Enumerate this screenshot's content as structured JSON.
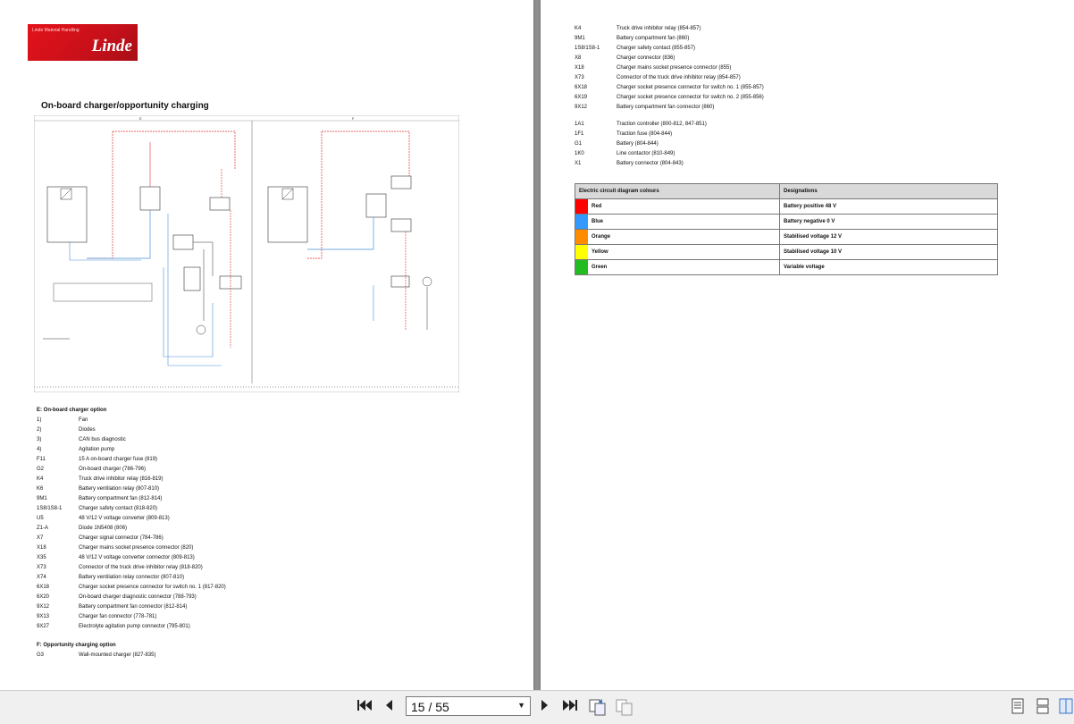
{
  "left_page": {
    "logo": {
      "subtitle": "Linde Material Handling",
      "brand": "Linde"
    },
    "title": "On-board charger/opportunity charging",
    "schematic_sections": [
      "E",
      "F"
    ],
    "legend_e": {
      "heading": "E: On-board charger option",
      "rows": [
        {
          "code": "1)",
          "desc": "Fan"
        },
        {
          "code": "2)",
          "desc": "Diodes"
        },
        {
          "code": "3)",
          "desc": "CAN bus diagnostic"
        },
        {
          "code": "4)",
          "desc": "Agitation pump"
        },
        {
          "code": "F11",
          "desc": "15 A on-board charger fuse (819)"
        },
        {
          "code": "G2",
          "desc": "On-board charger (786-796)"
        },
        {
          "code": "K4",
          "desc": "Truck drive inhibitor relay (816-819)"
        },
        {
          "code": "K6",
          "desc": "Battery ventilation relay (807-810)"
        },
        {
          "code": "9M1",
          "desc": "Battery compartment fan (812-814)"
        },
        {
          "code": "1S8/1S8-1",
          "desc": "Charger safety contact (818-820)"
        },
        {
          "code": "U5",
          "desc": "48 V/12 V voltage converter (809-813)"
        },
        {
          "code": "Z1-A",
          "desc": "Diode 1N5408 (806)"
        },
        {
          "code": "X7",
          "desc": "Charger signal connector (784-786)"
        },
        {
          "code": "X18",
          "desc": "Charger mains socket presence connector (820)"
        },
        {
          "code": "X35",
          "desc": "48 V/12 V voltage converter connector (809-813)"
        },
        {
          "code": "X73",
          "desc": "Connector of the truck drive inhibitor relay (818-820)"
        },
        {
          "code": "X74",
          "desc": "Battery ventilation relay connector (807-810)"
        },
        {
          "code": "6X18",
          "desc": "Charger socket presence connector for switch no. 1 (817-820)"
        },
        {
          "code": "6X20",
          "desc": "On-board charger diagnostic connector (788-793)"
        },
        {
          "code": "9X12",
          "desc": "Battery compartment fan connector (812-814)"
        },
        {
          "code": "9X13",
          "desc": "Charger fan connector (778-781)"
        },
        {
          "code": "9X27",
          "desc": "Electrolyte agitation pump connector (795-801)"
        }
      ]
    },
    "legend_f": {
      "heading": "F: Opportunity charging option",
      "rows": [
        {
          "code": "G3",
          "desc": "Wall-mounted charger (827-835)"
        }
      ]
    }
  },
  "right_page": {
    "legend_top": [
      {
        "code": "K4",
        "desc": "Truck drive inhibitor relay (854-857)"
      },
      {
        "code": "9M1",
        "desc": "Battery compartment fan (860)"
      },
      {
        "code": "1S8/1S8-1",
        "desc": "Charger safety contact (855-857)"
      },
      {
        "code": "X8",
        "desc": "Charger connector (836)"
      },
      {
        "code": "X18",
        "desc": "Charger mains socket presence connector (855)"
      },
      {
        "code": "X73",
        "desc": "Connector of the truck drive inhibitor relay (854-857)"
      },
      {
        "code": "6X18",
        "desc": "Charger socket presence connector for switch no. 1 (855-857)"
      },
      {
        "code": "6X19",
        "desc": "Charger socket presence connector for switch no. 2 (855-856)"
      },
      {
        "code": "9X12",
        "desc": "Battery compartment fan connector (860)"
      }
    ],
    "legend_bottom": [
      {
        "code": "1A1",
        "desc": "Traction controller (800-812, 847-851)"
      },
      {
        "code": "1F1",
        "desc": "Traction fuse (804-844)"
      },
      {
        "code": "G1",
        "desc": "Battery (804-844)"
      },
      {
        "code": "1K0",
        "desc": "Line contactor (810-849)"
      },
      {
        "code": "X1",
        "desc": "Battery connector (804-843)"
      }
    ],
    "color_table": {
      "headers": [
        "Electric circuit diagram colours",
        "Designations"
      ],
      "rows": [
        {
          "color_name": "Red",
          "hex": "#ff0000",
          "designation": "Battery positive 48 V"
        },
        {
          "color_name": "Blue",
          "hex": "#3399ff",
          "designation": "Battery negative 0 V"
        },
        {
          "color_name": "Orange",
          "hex": "#ff8c00",
          "designation": "Stabilised voltage 12 V"
        },
        {
          "color_name": "Yellow",
          "hex": "#ffff00",
          "designation": "Stabilised voltage 10 V"
        },
        {
          "color_name": "Green",
          "hex": "#22bb22",
          "designation": "Variable voltage"
        }
      ]
    }
  },
  "toolbar": {
    "page_value": "15 / 55",
    "buttons": [
      "first-page-icon",
      "prev-page-icon",
      "next-page-icon",
      "last-page-icon",
      "page-copy-icon",
      "page-paste-icon",
      "single-page-view-icon",
      "continuous-view-icon",
      "two-page-view-icon"
    ]
  },
  "colors": {
    "red": "#ff0000",
    "blue": "#3399ff",
    "wire_red": "#d33",
    "wire_blue": "#4a90d9"
  }
}
